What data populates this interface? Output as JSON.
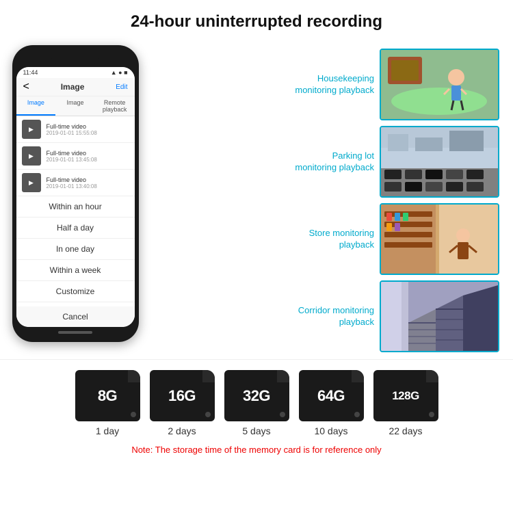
{
  "header": {
    "title": "24-hour uninterrupted recording"
  },
  "phone": {
    "time": "11:44",
    "screen_title": "Image",
    "nav_back": "<",
    "nav_edit": "Edit",
    "tabs": [
      "Image",
      "Image",
      "Remote playback"
    ],
    "videos": [
      {
        "title": "Full-time video",
        "date": "2019-01-01 15:55:08"
      },
      {
        "title": "Full-time video",
        "date": "2019-01-01 13:45:08"
      },
      {
        "title": "Full-time video",
        "date": "2019-01-01 13:40:08"
      }
    ],
    "dropdown_items": [
      "Within an hour",
      "Half a day",
      "In one day",
      "Within a week",
      "Customize"
    ],
    "cancel_label": "Cancel"
  },
  "monitoring": [
    {
      "label": "Housekeeping\nmonitoring playback",
      "img_type": "housekeeping"
    },
    {
      "label": "Parking lot\nmonitoring playback",
      "img_type": "parking"
    },
    {
      "label": "Store monitoring\nplayback",
      "img_type": "store"
    },
    {
      "label": "Corridor monitoring\nplayback",
      "img_type": "corridor"
    }
  ],
  "storage_cards": [
    {
      "size": "8G",
      "days": "1 day"
    },
    {
      "size": "16G",
      "days": "2 days"
    },
    {
      "size": "32G",
      "days": "5 days"
    },
    {
      "size": "64G",
      "days": "10 days"
    },
    {
      "size": "128G",
      "days": "22 days"
    }
  ],
  "storage_note": "Note: The storage time of the memory card is for reference only"
}
